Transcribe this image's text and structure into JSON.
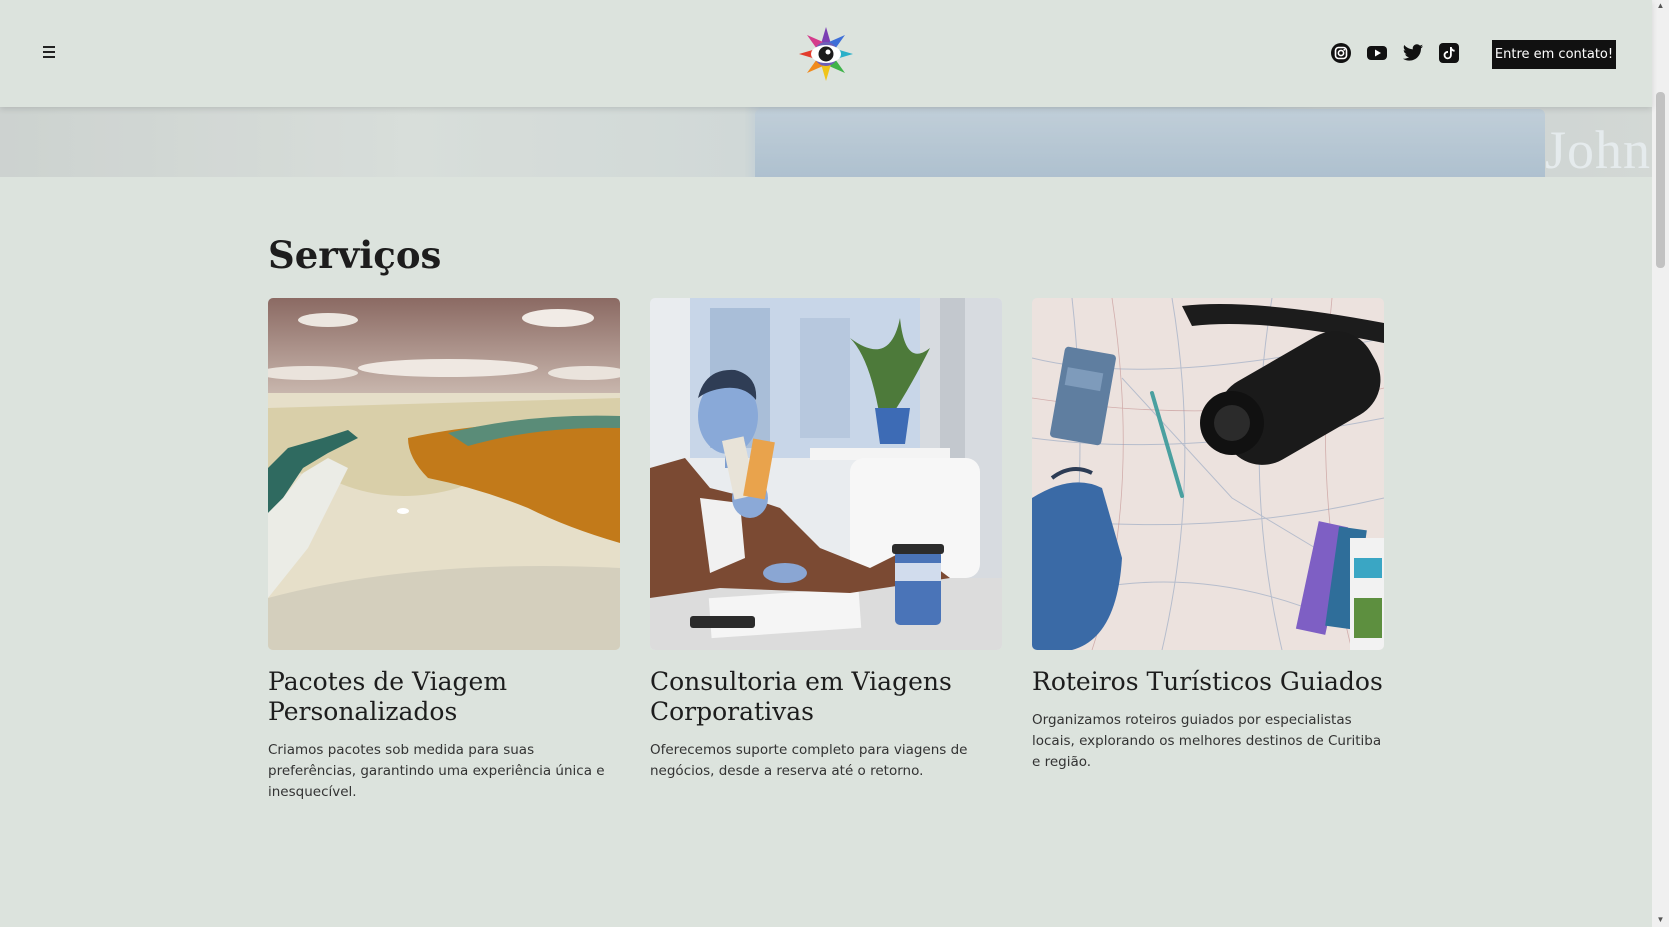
{
  "header": {
    "menu_icon": "hamburger-icon",
    "logo_icon": "rainbow-eye-logo",
    "socials": [
      {
        "name": "instagram-icon"
      },
      {
        "name": "youtube-icon"
      },
      {
        "name": "twitter-icon"
      },
      {
        "name": "tiktok-icon"
      }
    ],
    "cta_label": "Entre em contato!"
  },
  "hero": {
    "book_text": "John Grisham"
  },
  "services": {
    "title": "Serviços",
    "cards": [
      {
        "title": "Pacotes de Viagem Personalizados",
        "description": "Criamos pacotes sob medida para suas preferências, garantindo uma experiência única e inesquecível."
      },
      {
        "title": "Consultoria em Viagens Corporativas",
        "description": "Oferecemos suporte completo para viagens de negócios, desde a reserva até o retorno."
      },
      {
        "title": "Roteiros Turísticos Guiados",
        "description": "Organizamos roteiros guiados por especialistas locais, explorando os melhores destinos de Curitiba e região."
      }
    ]
  },
  "colors": {
    "background": "#dce3dd",
    "cta_background": "#111111",
    "text": "#1d1d1d"
  }
}
